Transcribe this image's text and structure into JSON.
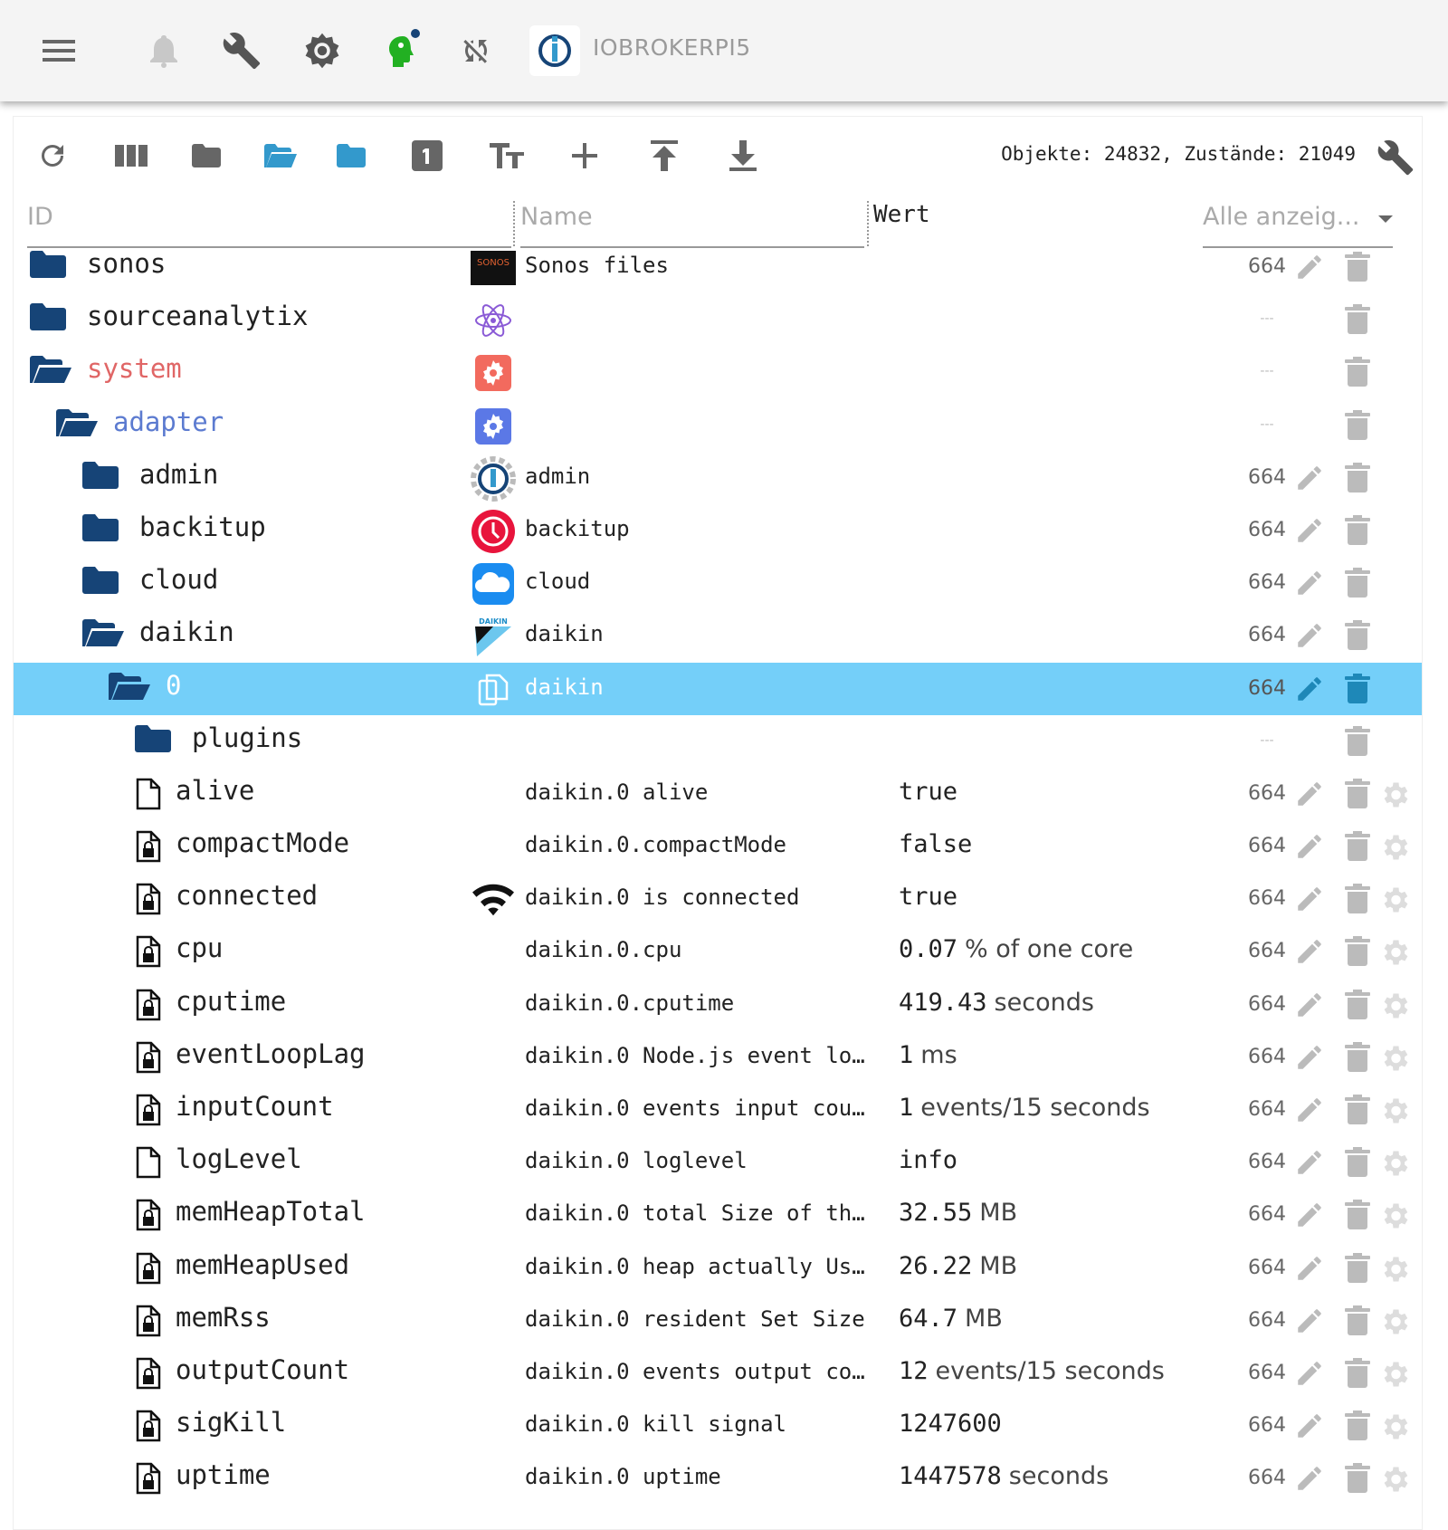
{
  "app": {
    "host": "IOBROKERPI5"
  },
  "topbar": {
    "icons": [
      "menu-icon",
      "bell-icon",
      "wrench-icon",
      "gear-icon",
      "expert-head-icon",
      "sync-off-icon"
    ]
  },
  "toolbar": {
    "icons": [
      "refresh-icon",
      "columns-icon",
      "folder-icon",
      "folder-open-icon",
      "folder-blue-icon",
      "number-one-icon",
      "text-size-icon",
      "add-icon",
      "upload-icon",
      "download-icon"
    ],
    "stats": "Objekte: 24832, Zustände: 21049"
  },
  "columns": {
    "id": "ID",
    "name": "Name",
    "value": "Wert",
    "filter": "Alle anzeig..."
  },
  "colors": {
    "selected": "#74cff9",
    "folder": "#164477",
    "system": "#e06666",
    "adapter": "#5c7bd0"
  },
  "sonos_logo": "SONOS",
  "daikin_logo": "DAIKIN",
  "rows": [
    {
      "id": "sonos",
      "level": 0,
      "icon": "folder",
      "nicon": "sonos",
      "name": "Sonos files",
      "value": "",
      "unit": "",
      "perm": "664",
      "edit": true,
      "gear": false
    },
    {
      "id": "sourceanalytix",
      "level": 0,
      "icon": "folder",
      "nicon": "atom",
      "name": "",
      "value": "",
      "unit": "",
      "perm": "---",
      "edit": false,
      "gear": false
    },
    {
      "id": "system",
      "level": 0,
      "icon": "folder-open",
      "nicon": "gear-red",
      "name": "",
      "value": "",
      "unit": "",
      "perm": "---",
      "edit": false,
      "gear": false,
      "color": "system"
    },
    {
      "id": "adapter",
      "level": 1,
      "icon": "folder-open",
      "nicon": "gear-blue",
      "name": "",
      "value": "",
      "unit": "",
      "perm": "---",
      "edit": false,
      "gear": false,
      "color": "adapter"
    },
    {
      "id": "admin",
      "level": 2,
      "icon": "folder",
      "nicon": "iobroker",
      "name": "admin",
      "value": "",
      "unit": "",
      "perm": "664",
      "edit": true,
      "gear": false
    },
    {
      "id": "backitup",
      "level": 2,
      "icon": "folder",
      "nicon": "backitup",
      "name": "backitup",
      "value": "",
      "unit": "",
      "perm": "664",
      "edit": true,
      "gear": false
    },
    {
      "id": "cloud",
      "level": 2,
      "icon": "folder",
      "nicon": "cloud",
      "name": "cloud",
      "value": "",
      "unit": "",
      "perm": "664",
      "edit": true,
      "gear": false
    },
    {
      "id": "daikin",
      "level": 2,
      "icon": "folder-open",
      "nicon": "daikin",
      "name": "daikin",
      "value": "",
      "unit": "",
      "perm": "664",
      "edit": true,
      "gear": false
    },
    {
      "id": "0",
      "level": 3,
      "icon": "folder-open",
      "nicon": "copy",
      "name": "daikin",
      "value": "",
      "unit": "",
      "perm": "664",
      "edit": true,
      "gear": false,
      "selected": true
    },
    {
      "id": "plugins",
      "level": 4,
      "icon": "folder",
      "nicon": "",
      "name": "",
      "value": "",
      "unit": "",
      "perm": "---",
      "edit": false,
      "gear": false
    },
    {
      "id": "alive",
      "level": 4,
      "icon": "file",
      "nicon": "",
      "name": "daikin.0 alive",
      "value": "true",
      "unit": "",
      "perm": "664",
      "edit": true,
      "gear": true
    },
    {
      "id": "compactMode",
      "level": 4,
      "icon": "file-lock",
      "nicon": "",
      "name": "daikin.0.compactMode",
      "value": "false",
      "unit": "",
      "perm": "664",
      "edit": true,
      "gear": true
    },
    {
      "id": "connected",
      "level": 4,
      "icon": "file-lock",
      "nicon": "wifi",
      "name": "daikin.0 is connected",
      "value": "true",
      "unit": "",
      "perm": "664",
      "edit": true,
      "gear": true
    },
    {
      "id": "cpu",
      "level": 4,
      "icon": "file-lock",
      "nicon": "",
      "name": "daikin.0.cpu",
      "value": "0.07",
      "unit": "% of one core",
      "perm": "664",
      "edit": true,
      "gear": true
    },
    {
      "id": "cputime",
      "level": 4,
      "icon": "file-lock",
      "nicon": "",
      "name": "daikin.0.cputime",
      "value": "419.43",
      "unit": "seconds",
      "perm": "664",
      "edit": true,
      "gear": true
    },
    {
      "id": "eventLoopLag",
      "level": 4,
      "icon": "file-lock",
      "nicon": "",
      "name": "daikin.0 Node.js event lo…",
      "value": "1",
      "unit": "ms",
      "perm": "664",
      "edit": true,
      "gear": true
    },
    {
      "id": "inputCount",
      "level": 4,
      "icon": "file-lock",
      "nicon": "",
      "name": "daikin.0 events input cou…",
      "value": "1",
      "unit": "events/15 seconds",
      "perm": "664",
      "edit": true,
      "gear": true
    },
    {
      "id": "logLevel",
      "level": 4,
      "icon": "file",
      "nicon": "",
      "name": "daikin.0 loglevel",
      "value": "info",
      "unit": "",
      "perm": "664",
      "edit": true,
      "gear": true
    },
    {
      "id": "memHeapTotal",
      "level": 4,
      "icon": "file-lock",
      "nicon": "",
      "name": "daikin.0 total Size of th…",
      "value": "32.55",
      "unit": "MB",
      "perm": "664",
      "edit": true,
      "gear": true
    },
    {
      "id": "memHeapUsed",
      "level": 4,
      "icon": "file-lock",
      "nicon": "",
      "name": "daikin.0 heap actually Us…",
      "value": "26.22",
      "unit": "MB",
      "perm": "664",
      "edit": true,
      "gear": true
    },
    {
      "id": "memRss",
      "level": 4,
      "icon": "file-lock",
      "nicon": "",
      "name": "daikin.0 resident Set Size",
      "value": "64.7",
      "unit": "MB",
      "perm": "664",
      "edit": true,
      "gear": true
    },
    {
      "id": "outputCount",
      "level": 4,
      "icon": "file-lock",
      "nicon": "",
      "name": "daikin.0 events output co…",
      "value": "12",
      "unit": "events/15 seconds",
      "perm": "664",
      "edit": true,
      "gear": true
    },
    {
      "id": "sigKill",
      "level": 4,
      "icon": "file-lock",
      "nicon": "",
      "name": "daikin.0 kill signal",
      "value": "1247600",
      "unit": "",
      "perm": "664",
      "edit": true,
      "gear": true
    },
    {
      "id": "uptime",
      "level": 4,
      "icon": "file-lock",
      "nicon": "",
      "name": "daikin.0 uptime",
      "value": "1447578",
      "unit": "seconds",
      "perm": "664",
      "edit": true,
      "gear": true
    }
  ]
}
